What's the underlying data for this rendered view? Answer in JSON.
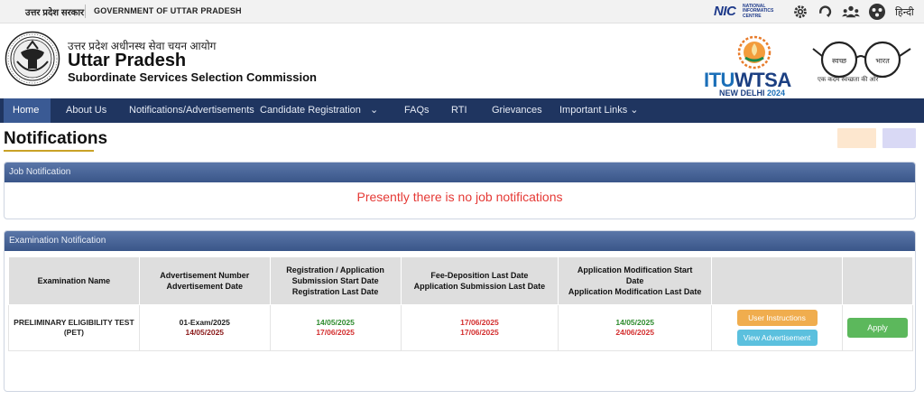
{
  "topbar": {
    "gov_hindi": "उत्तर प्रदेश सरकार",
    "gov_english": "GOVERNMENT OF UTTAR PRADESH",
    "nic_mark": "NIC",
    "nic_text": "NATIONAL INFORMATICS CENTRE",
    "icons": [
      "gear-icon",
      "screen-reader-icon",
      "sitemap-icon",
      "contrast-icon"
    ],
    "lang_toggle": "हिन्दी"
  },
  "header": {
    "org_hindi": "उत्तर प्रदेश अधीनस्थ सेवा चयन आयोग",
    "org_name": "Uttar Pradesh",
    "org_sub": "Subordinate Services Selection Commission",
    "itu_part1": "ITU",
    "itu_part2": "WTSA",
    "itu_city": "NEW DELHI",
    "itu_year": "2024",
    "swachh_left": "स्वच्छ",
    "swachh_right": "भारत",
    "swachh_caption": "एक कदम स्वच्छता की ओर"
  },
  "nav": {
    "items": [
      {
        "label": "Home"
      },
      {
        "label": "About Us"
      },
      {
        "label": "Notifications/Advertisements"
      },
      {
        "label": "Candidate Registration"
      },
      {
        "label": "⌄"
      },
      {
        "label": "FAQs"
      },
      {
        "label": "RTI"
      },
      {
        "label": "Grievances"
      },
      {
        "label": "Important Links ⌄"
      }
    ]
  },
  "page": {
    "title": "Notifications"
  },
  "job_panel": {
    "heading": "Job Notification",
    "empty_message": "Presently there is no job notifications"
  },
  "exam_panel": {
    "heading": "Examination Notification",
    "columns": [
      [
        "Examination Name"
      ],
      [
        "Advertisement Number",
        "Advertisement Date"
      ],
      [
        "Registration / Application",
        "Submission  Start Date",
        "Registration Last Date"
      ],
      [
        "Fee-Deposition Last Date",
        "Application Submission Last Date"
      ],
      [
        "Application Modification Start",
        "Date",
        "Application Modification Last Date"
      ],
      [
        ""
      ],
      [
        ""
      ]
    ],
    "rows": [
      {
        "exam_name": "PRELIMINARY ELIGIBILITY TEST (PET)",
        "adv_number": "01-Exam/2025",
        "adv_date": "14/05/2025",
        "reg_start": "14/05/2025",
        "reg_last": "17/06/2025",
        "fee_last": "17/06/2025",
        "app_last": "17/06/2025",
        "mod_start": "14/05/2025",
        "mod_last": "24/06/2025",
        "btn_instructions": "User Instructions",
        "btn_view_adv": "View Advertisement",
        "btn_apply": "Apply"
      }
    ]
  },
  "colors": {
    "navbar": "#1f3560",
    "panel_header": "#4a6699",
    "empty_message": "#e53935",
    "green_date": "#2e8b2e",
    "red_date": "#d32f2f",
    "btn_orange": "#f0ad4e",
    "btn_blue": "#5bc0de",
    "btn_green": "#5cb85c"
  }
}
